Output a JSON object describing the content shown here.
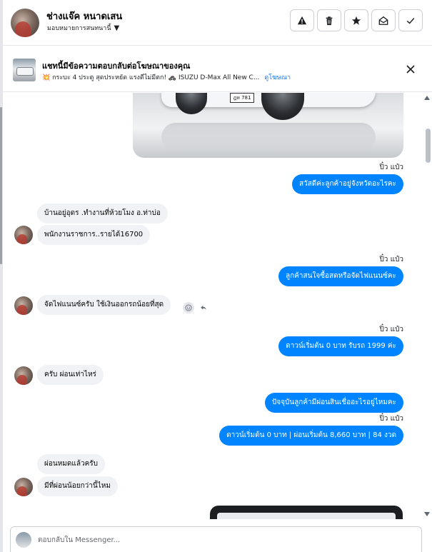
{
  "header": {
    "contact_name": "ช่างแจ๊ค หนาดเสน",
    "assign_label": "มอบหมายการสนทนานี้",
    "actions": [
      {
        "name": "report-button",
        "icon": "warning-icon"
      },
      {
        "name": "delete-button",
        "icon": "trash-icon"
      },
      {
        "name": "star-button",
        "icon": "star-icon"
      },
      {
        "name": "mark-unread-button",
        "icon": "envelope-open-icon"
      },
      {
        "name": "done-button",
        "icon": "check-icon"
      }
    ]
  },
  "ad": {
    "title": "แชทนี้มีข้อความตอบกลับต่อโฆษณาของคุณ",
    "description": "💥 กระบะ 4 ประตู สุดประหยัด แรงดีไม่มีตก! 🚓 ISUZU D-Max All New C...",
    "link": "ดูโฆษณา"
  },
  "image_message": {
    "plate_text": "ฎห 781"
  },
  "messages": [
    {
      "dir": "out",
      "sender": "ปิ๋ว แป๋ว",
      "text": "สวัสดีค่ะลูกค้าอยู่จังหวัดอะไรคะ"
    },
    {
      "dir": "in",
      "text": "บ้านอยู่อุดร .ทำงานที่ห้วยโมง อ.ท่าบ่อ"
    },
    {
      "dir": "in",
      "text": "พนักงานราชการ..รายได้16700"
    },
    {
      "dir": "out",
      "sender": "ปิ๋ว แป๋ว",
      "text": "ลูกค้าสนใจซื้อสดหรือจัดไฟแนนซ์คะ"
    },
    {
      "dir": "in",
      "text": "จัดไฟแนนซ์ครับ ใช้เงินออกรถน้อยที่สุด"
    },
    {
      "dir": "out",
      "sender": "ปิ๋ว แป๋ว",
      "text": "ดาวน์เริ่มต้น 0 บาท รับรถ 1999 ค่ะ"
    },
    {
      "dir": "in",
      "text": "ครับ ผ่อนเท่าไหร่"
    },
    {
      "dir": "out",
      "text": "ปัจจุบันลูกค้ามีผ่อนสินเชื่ออะไรอยู่ไหมคะ"
    },
    {
      "dir": "out",
      "sender": "ปิ๋ว แป๋ว",
      "text": "ดาวน์เริ่มต้น 0 บาท | ผ่อนเริ่มต้น 8,660 บาท | 84 งวด"
    },
    {
      "dir": "in",
      "text": "ผ่อนหมดแล้วครับ"
    },
    {
      "dir": "in",
      "text": "มีที่ผ่อนน้อยกว่านี้ไหม"
    }
  ],
  "composer": {
    "placeholder": "ตอบกลับใน Messenger..."
  }
}
